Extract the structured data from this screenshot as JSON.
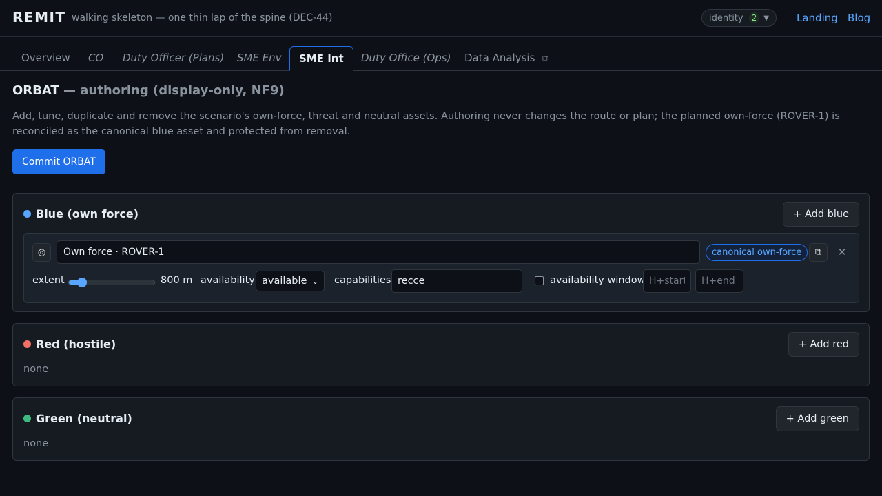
{
  "app": {
    "brand": "REMIT",
    "tagline": "walking skeleton — one thin lap of the spine (DEC-44)"
  },
  "header": {
    "identity_label": "identity",
    "identity_count": "2",
    "links": [
      "Landing",
      "Blog"
    ]
  },
  "tabs": [
    {
      "label": "Overview"
    },
    {
      "label": "CO"
    },
    {
      "label": "Duty Officer (Plans)"
    },
    {
      "label": "SME Env"
    },
    {
      "label": "SME Int",
      "active": true
    },
    {
      "label": "Duty Office (Ops)"
    },
    {
      "label": "Data Analysis"
    }
  ],
  "page": {
    "title": "ORBAT",
    "subtitle": "— authoring (display-only, NF9)",
    "description": "Add, tune, duplicate and remove the scenario's own-force, threat and neutral assets. Authoring never changes the route or plan; the planned own-force (ROVER-1) is reconciled as the canonical blue asset and protected from removal.",
    "commit_label": "Commit ORBAT"
  },
  "panels": {
    "blue": {
      "title": "Blue (own force)",
      "color": "#58a6ff",
      "add_label": "+ Add blue",
      "asset": {
        "name": "Own force · ROVER-1",
        "badge": "canonical own-force",
        "extent_label": "extent",
        "extent_value": "800 m",
        "extent_fraction": 0.15,
        "availability_label": "availability",
        "availability_value": "available",
        "capabilities_label": "capabilities",
        "capabilities_value": "recce",
        "window_label": "availability window",
        "window_start_placeholder": "H+start",
        "window_end_placeholder": "H+end"
      }
    },
    "red": {
      "title": "Red (hostile)",
      "color": "#f47067",
      "add_label": "+ Add red",
      "empty_text": "none"
    },
    "green": {
      "title": "Green (neutral)",
      "color": "#3fb97f",
      "add_label": "+ Add green",
      "empty_text": "none"
    }
  }
}
